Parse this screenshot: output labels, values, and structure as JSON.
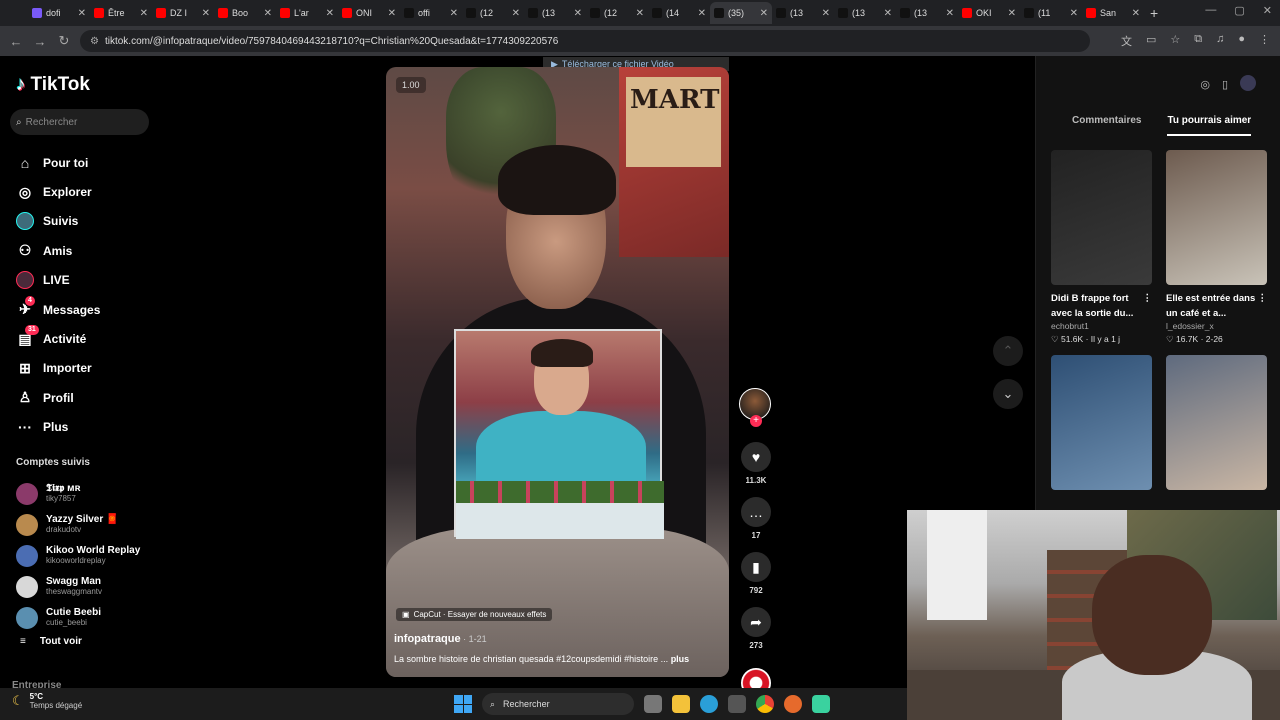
{
  "browser": {
    "tabs": [
      {
        "label": "dofi",
        "color": "#7a5af8"
      },
      {
        "label": "Être",
        "color": "#ff0000"
      },
      {
        "label": "DZ I",
        "color": "#ff0000"
      },
      {
        "label": "Boo",
        "color": "#ff0000"
      },
      {
        "label": "L'ar",
        "color": "#ff0000"
      },
      {
        "label": "ONI",
        "color": "#ff0000"
      },
      {
        "label": "offi",
        "color": "#111111"
      },
      {
        "label": "(12",
        "color": "#111111"
      },
      {
        "label": "(13",
        "color": "#111111"
      },
      {
        "label": "(12",
        "color": "#111111"
      },
      {
        "label": "(14",
        "color": "#111111"
      },
      {
        "label": "(35)",
        "color": "#111111"
      },
      {
        "label": "(13",
        "color": "#111111"
      },
      {
        "label": "(13",
        "color": "#111111"
      },
      {
        "label": "(13",
        "color": "#111111"
      },
      {
        "label": "OKI",
        "color": "#ff0000"
      },
      {
        "label": "(11",
        "color": "#111111"
      },
      {
        "label": "San",
        "color": "#ff0000"
      }
    ],
    "active_tab_index": 11,
    "url": "tiktok.com/@infopatraque/video/7597840469443218710?q=Christian%20Quesada&t=1774309220576"
  },
  "sidebar": {
    "logo": "TikTok",
    "search_placeholder": "Rechercher",
    "nav": [
      {
        "label": "Pour toi",
        "icon": "home-icon"
      },
      {
        "label": "Explorer",
        "icon": "compass-icon"
      },
      {
        "label": "Suivis",
        "icon": "following-avatar-icon"
      },
      {
        "label": "Amis",
        "icon": "friends-icon"
      },
      {
        "label": "LIVE",
        "icon": "live-icon"
      },
      {
        "label": "Messages",
        "icon": "messages-icon",
        "badge": "4"
      },
      {
        "label": "Activité",
        "icon": "activity-icon",
        "badge": "31"
      },
      {
        "label": "Importer",
        "icon": "upload-icon"
      },
      {
        "label": "Profil",
        "icon": "profile-icon"
      },
      {
        "label": "Plus",
        "icon": "more-icon"
      }
    ],
    "followed_title": "Comptes suivis",
    "followed": [
      {
        "name": "𝕿𝖎𝖝𝖕 ᴍʀ",
        "user": "tiky7857",
        "color": "#8b3a6a"
      },
      {
        "name": "Yazzy Silver 🧧",
        "user": "drakudotv",
        "color": "#b98a4e"
      },
      {
        "name": "Kikoo World Replay",
        "user": "kikooworldreplay",
        "color": "#4b6db3"
      },
      {
        "name": "Swagg Man",
        "user": "theswaggmantv",
        "color": "#d8d8d8"
      },
      {
        "name": "Cutie Beebi",
        "user": "cutie_beebi",
        "color": "#5a8fb0"
      }
    ],
    "see_all": "Tout voir",
    "entreprise": "Entreprise"
  },
  "video": {
    "speed": "1.00",
    "poster_text": "MART",
    "download_banner": "Télécharger ce fichier Vidéo",
    "effect": "CapCut · Essayer de nouveaux effets",
    "author": "infopatraque",
    "date": " · 1-21",
    "description": "La sombre histoire de christian quesada #12coupsdemidi #histoire ...",
    "more": "plus"
  },
  "actions": {
    "likes": "11.3K",
    "comments": "17",
    "saves": "792",
    "shares": "273"
  },
  "right_panel": {
    "tabs": [
      "Commentaires",
      "Tu pourrais aimer"
    ],
    "active_tab": 1,
    "cards": [
      {
        "title": "Didi B frappe fort avec la sortie du...",
        "user": "echobrut1",
        "likes": "51.6K",
        "age": "Il y a 1 j",
        "colors": [
          "#222",
          "#3a3a3a"
        ]
      },
      {
        "title": "Elle est entrée dans un café et a...",
        "user": "l_edossier_x",
        "likes": "16.7K",
        "age": "2-26",
        "colors": [
          "#6d5b4f",
          "#c9c3b8"
        ]
      },
      {
        "title": "",
        "user": "",
        "likes": "",
        "age": "",
        "colors": [
          "#2e4f74",
          "#6e8fb0"
        ]
      },
      {
        "title": "",
        "user": "",
        "likes": "",
        "age": "",
        "colors": [
          "#5e6a7e",
          "#c9b6a4"
        ]
      }
    ]
  },
  "taskbar": {
    "temp": "5°C",
    "weather": "Temps dégagé",
    "search": "Rechercher"
  }
}
